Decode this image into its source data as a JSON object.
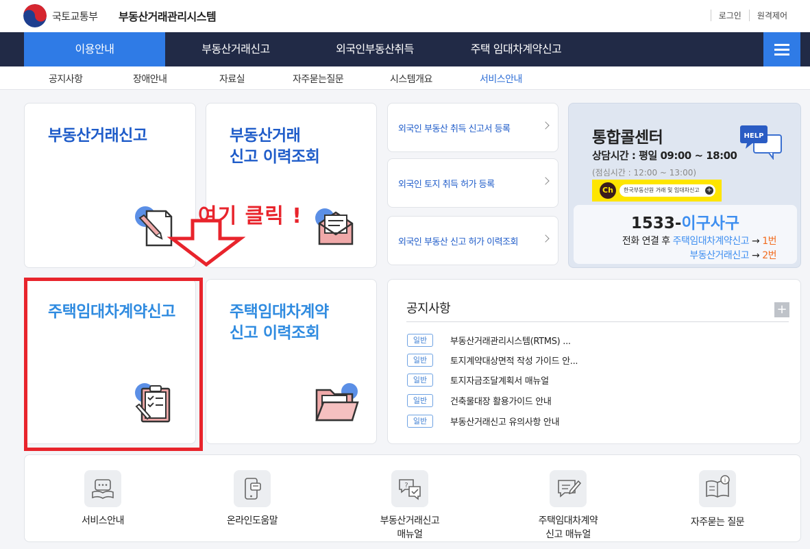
{
  "header": {
    "ministry": "국토교통부",
    "system_title": "부동산거래관리시스템",
    "login": "로그인",
    "remote_control": "원격제어"
  },
  "gnb": {
    "items": [
      "이용안내",
      "부동산거래신고",
      "외국인부동산취득",
      "주택 임대차계약신고"
    ],
    "active_index": 0,
    "menu_icon": "hamburger-icon"
  },
  "subnav": {
    "items": [
      "공지사항",
      "장애안내",
      "자료실",
      "자주묻는질문",
      "시스템개요",
      "서비스안내"
    ],
    "active_index": 5
  },
  "cards": {
    "realestate_report": "부동산거래신고",
    "realestate_history": "부동산거래\n신고 이력조회",
    "lease_report": "주택임대차계약신고",
    "lease_history": "주택임대차계약\n신고 이력조회"
  },
  "foreign_links": [
    "외국인 부동산 취득 신고서 등록",
    "외국인 토지 취득 허가 등록",
    "외국인 부동산 신고 허가 이력조회"
  ],
  "call_center": {
    "title": "통합콜센터",
    "hours_label": "상담시간 : 평일 ",
    "hours_value": "09:00 ~ 18:00",
    "lunch": "(점심시간 : 12:00 ~ 13:00)",
    "kakao_ch": "Ch",
    "kakao_text": "한국부동산원 거래 및 임대차신고",
    "help_bubble": "HELP",
    "phone_prefix": "1533-",
    "phone_word": "이구사구",
    "route1_prefix": "전화 연결 후 ",
    "route1_service": "주택임대차계약신고",
    "route1_arrow": " → ",
    "route1_num": "1번",
    "route2_service": "부동산거래신고",
    "route2_arrow": " → ",
    "route2_num": "2번"
  },
  "notice": {
    "title": "공지사항",
    "more": "+",
    "items": [
      {
        "badge": "일반",
        "text": "부동산거래관리시스템(RTMS) ..."
      },
      {
        "badge": "일반",
        "text": "토지계약대상면적 작성 가이드 안..."
      },
      {
        "badge": "일반",
        "text": "토지자금조달계획서 매뉴얼"
      },
      {
        "badge": "일반",
        "text": "건축물대장 활용가이드 안내"
      },
      {
        "badge": "일반",
        "text": "부동산거래신고 유의사항 안내"
      }
    ]
  },
  "shortcuts": [
    {
      "label": "서비스안내",
      "icon": "book-chat-icon"
    },
    {
      "label": "온라인도움말",
      "icon": "mobile-chat-icon"
    },
    {
      "label": "부동산거래신고\n매뉴얼",
      "icon": "speech-check-icon"
    },
    {
      "label": "주택임대차계약\n신고 매뉴얼",
      "icon": "edit-chat-icon"
    },
    {
      "label": "자주묻는 질문",
      "icon": "book-info-icon"
    }
  ],
  "annotation": {
    "text": "여기 클릭 !",
    "color": "#e8242c"
  },
  "colors": {
    "navy": "#212a46",
    "accent_blue": "#2f7be6",
    "title_blue": "#1f5cc9",
    "highlight_red": "#e8242c"
  }
}
